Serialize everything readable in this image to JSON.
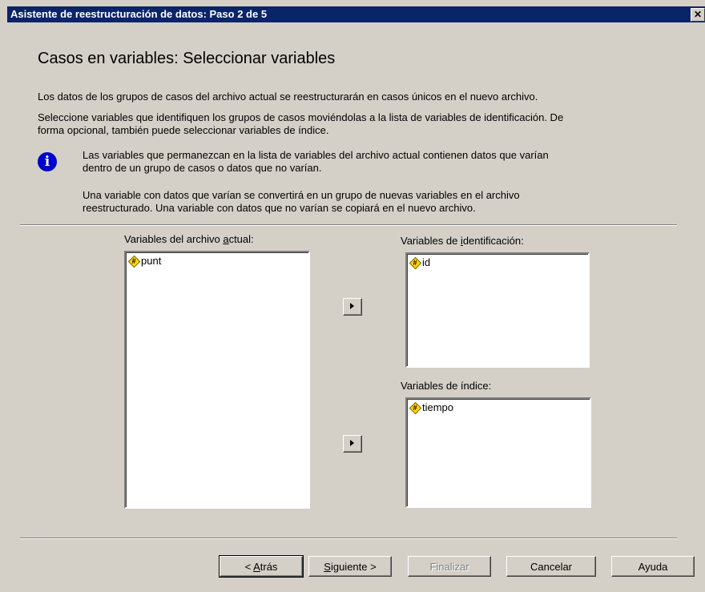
{
  "window": {
    "title": "Asistente de reestructuración de datos: Paso 2 de 5",
    "close_glyph": "✕"
  },
  "heading": "Casos en variables: Seleccionar variables",
  "paragraphs": {
    "p1": "Los datos de los grupos de casos del archivo actual se reestructurarán en casos únicos en el nuevo archivo.",
    "p2_line1": "Seleccione variables que identifiquen los grupos de casos moviéndolas a la lista de variables de identificación. De",
    "p2_line2": "forma opcional, también puede seleccionar variables de índice.",
    "info1_line1": "Las variables que permanezcan en la lista de variables del archivo actual contienen datos que varían",
    "info1_line2": "dentro de un grupo de casos o datos que no varían.",
    "info2_line1": "Una variable con datos que varían se convertirá en un grupo de nuevas variables en el archivo",
    "info2_line2": "reestructurado. Una variable con datos que no varían se copiará en el nuevo archivo."
  },
  "lists": {
    "current": {
      "label_pre": "Variables del archivo ",
      "label_u": "a",
      "label_post": "ctual:",
      "items": [
        "punt"
      ]
    },
    "id": {
      "label_pre": "Variables de ",
      "label_u": "i",
      "label_post": "dentificación:",
      "items": [
        "id"
      ]
    },
    "index": {
      "label": "Variables de índice:",
      "items": [
        "tiempo"
      ]
    }
  },
  "buttons": {
    "back_pre": "< ",
    "back_u": "A",
    "back_post": "trás",
    "next_u": "S",
    "next_post": "iguiente >",
    "finish": "Finalizar",
    "cancel": "Cancelar",
    "help": "Ayuda"
  },
  "icons": {
    "variable": "numeric-variable-icon",
    "info": "info-icon",
    "arrow": "right-arrow-icon"
  }
}
